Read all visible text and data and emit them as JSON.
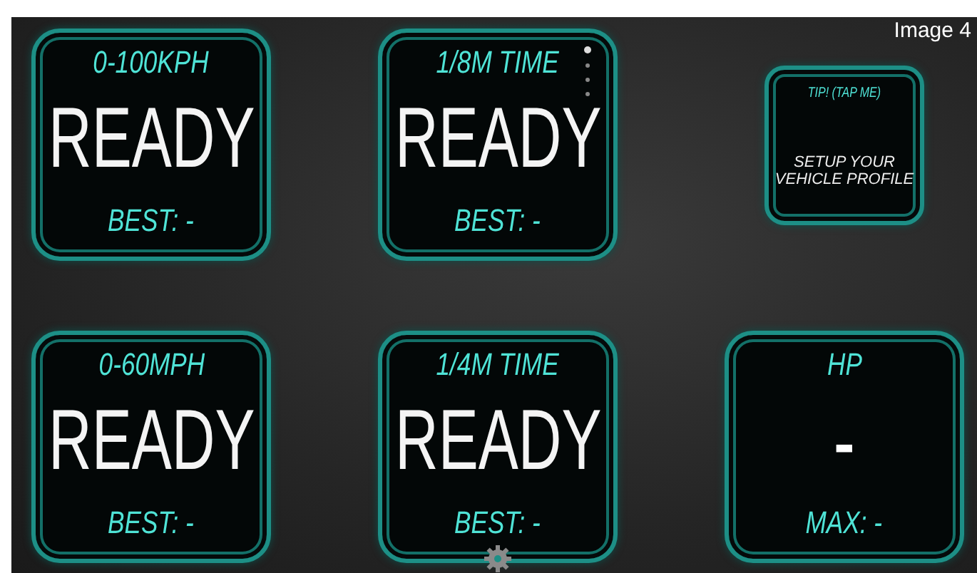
{
  "caption": "Image 4",
  "tiles": [
    {
      "kind": "timer",
      "title": "0-100KPH",
      "value": "READY",
      "footer": "BEST: -"
    },
    {
      "kind": "timer",
      "title": "1/8M TIME",
      "value": "READY",
      "footer": "BEST: -"
    },
    {
      "kind": "tip",
      "title": "TIP! (TAP ME)",
      "value": "SETUP YOUR VEHICLE PROFILE"
    },
    {
      "kind": "timer",
      "title": "0-60MPH",
      "value": "READY",
      "footer": "BEST: -"
    },
    {
      "kind": "timer",
      "title": "1/4M TIME",
      "value": "READY",
      "footer": "BEST: -"
    },
    {
      "kind": "power",
      "title": "HP",
      "value": "-",
      "footer": "MAX: -"
    }
  ]
}
